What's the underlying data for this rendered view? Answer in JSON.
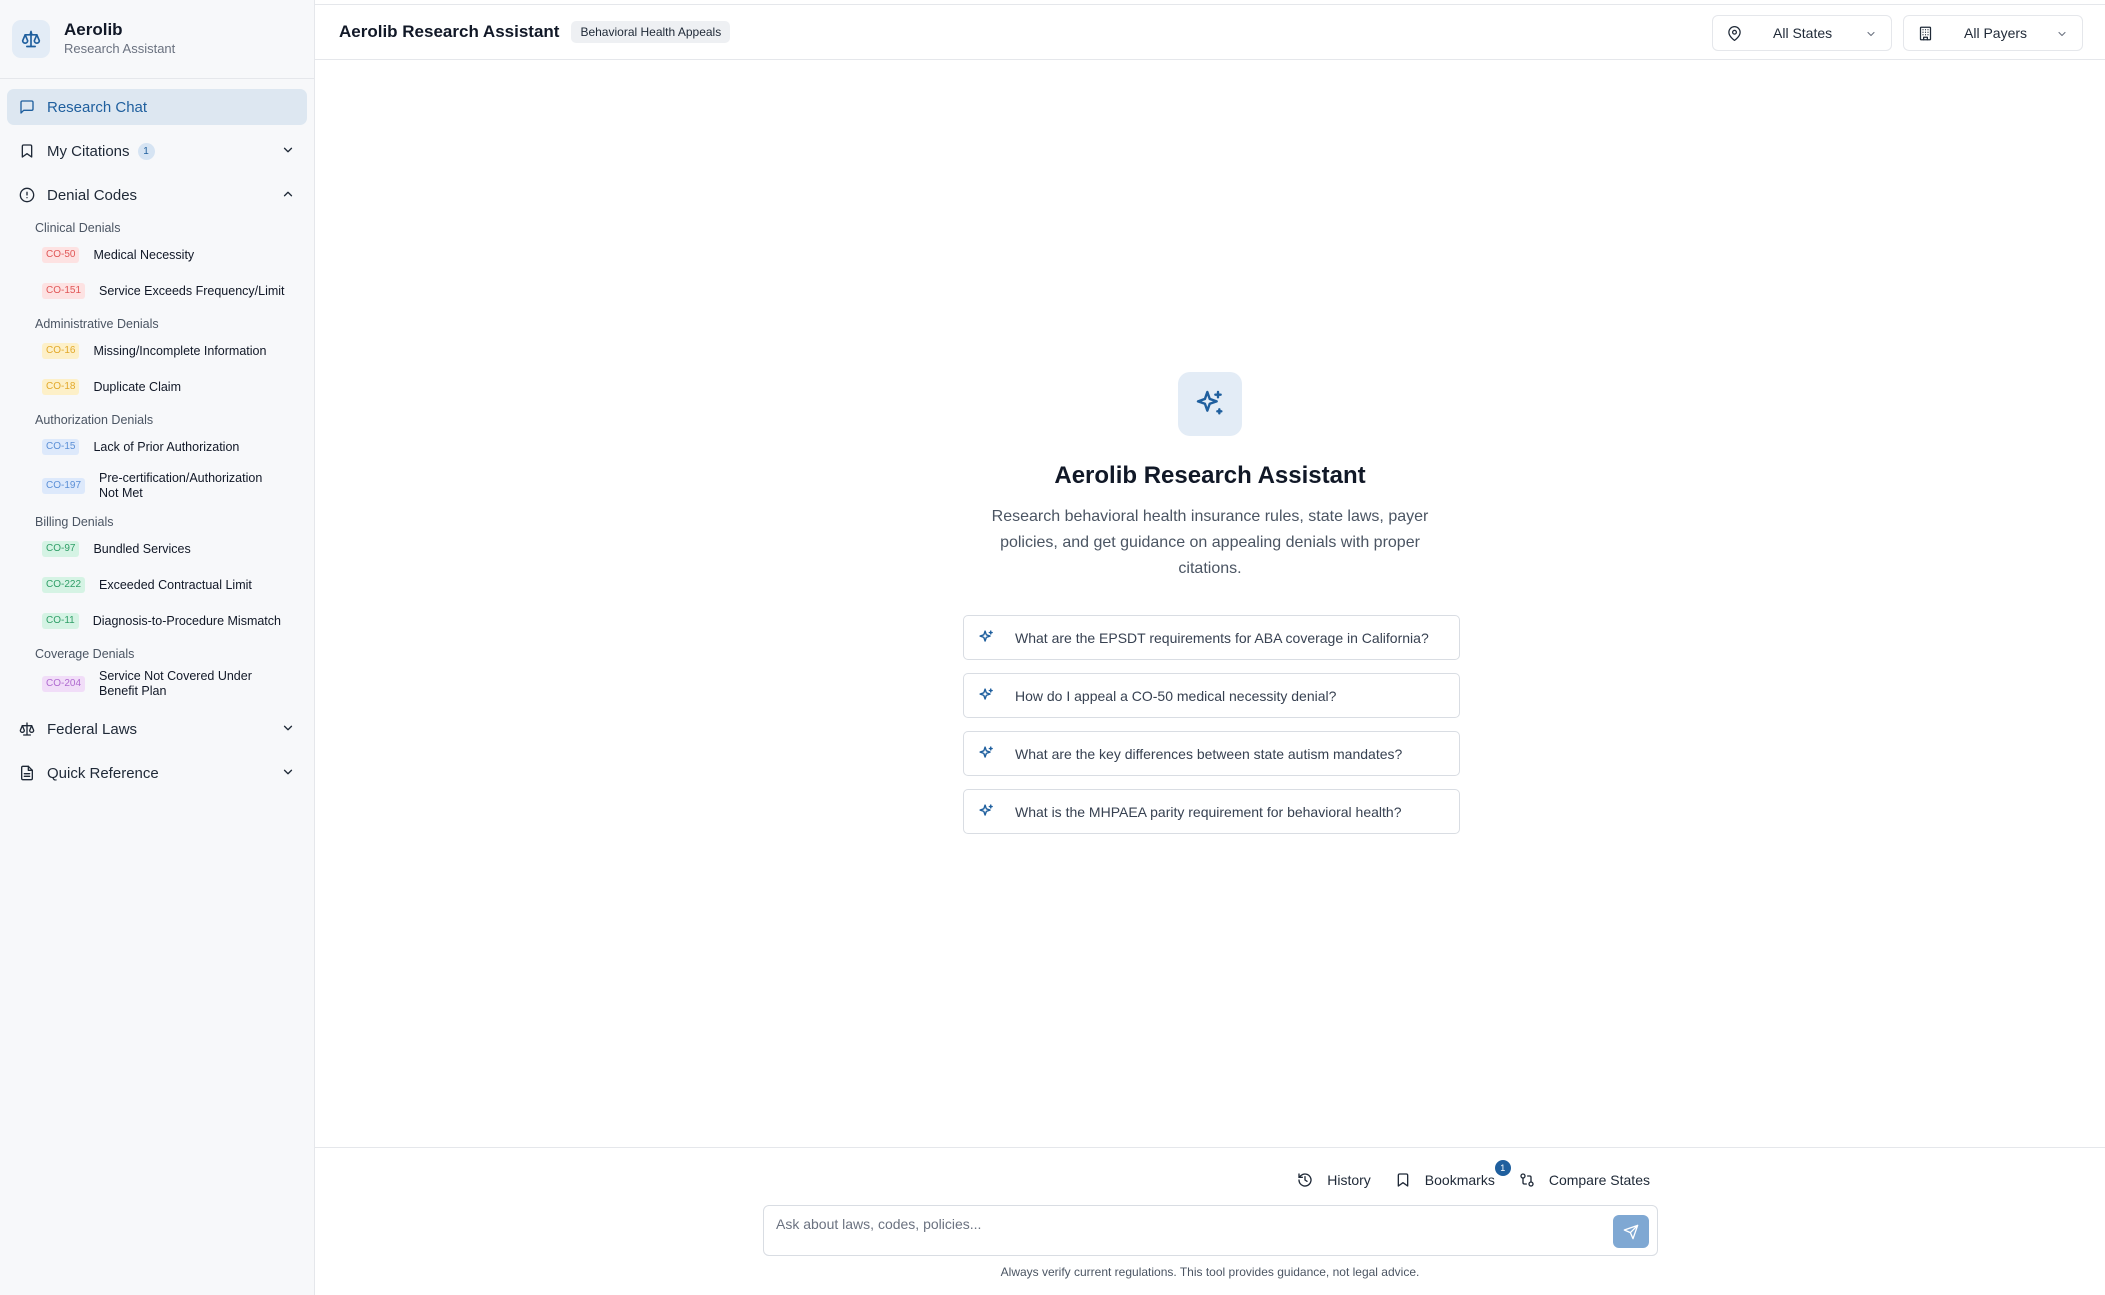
{
  "brand": {
    "name": "Aerolib",
    "subtitle": "Research Assistant"
  },
  "sidebar": {
    "research_chat": "Research Chat",
    "my_citations": {
      "label": "My Citations",
      "count": "1"
    },
    "denial_codes": "Denial Codes",
    "groups": [
      {
        "title": "Clinical Denials",
        "items": [
          {
            "code": "CO-50",
            "label": "Medical Necessity",
            "color": "#e05757"
          },
          {
            "code": "CO-151",
            "label": "Service Exceeds Frequency/Limit",
            "color": "#e05757"
          }
        ]
      },
      {
        "title": "Administrative Denials",
        "items": [
          {
            "code": "CO-16",
            "label": "Missing/Incomplete Information",
            "color": "#e2a82a"
          },
          {
            "code": "CO-18",
            "label": "Duplicate Claim",
            "color": "#e2a82a"
          }
        ]
      },
      {
        "title": "Authorization Denials",
        "items": [
          {
            "code": "CO-15",
            "label": "Lack of Prior Authorization",
            "color": "#5b8fd6"
          },
          {
            "code": "CO-197",
            "label": "Pre-certification/Authorization Not Met",
            "color": "#5b8fd6"
          }
        ]
      },
      {
        "title": "Billing Denials",
        "items": [
          {
            "code": "CO-97",
            "label": "Bundled Services",
            "color": "#2f9e67"
          },
          {
            "code": "CO-222",
            "label": "Exceeded Contractual Limit",
            "color": "#2f9e67"
          },
          {
            "code": "CO-11",
            "label": "Diagnosis-to-Procedure Mismatch",
            "color": "#2f9e67"
          }
        ]
      },
      {
        "title": "Coverage Denials",
        "items": [
          {
            "code": "CO-204",
            "label": "Service Not Covered Under Benefit Plan",
            "color": "#b06bd0"
          }
        ]
      }
    ],
    "federal_laws": "Federal Laws",
    "quick_reference": "Quick Reference"
  },
  "header": {
    "title": "Aerolib Research Assistant",
    "badge": "Behavioral Health Appeals",
    "state_filter": "All States",
    "payer_filter": "All Payers"
  },
  "hero": {
    "title": "Aerolib Research Assistant",
    "description": "Research behavioral health insurance rules, state laws, payer policies, and get guidance on appealing denials with proper citations."
  },
  "suggestions": [
    "What are the EPSDT requirements for ABA coverage in California?",
    "How do I appeal a CO-50 medical necessity denial?",
    "What are the key differences between state autism mandates?",
    "What is the MHPAEA parity requirement for behavioral health?"
  ],
  "footer": {
    "history": "History",
    "bookmarks": "Bookmarks",
    "bookmarks_count": "1",
    "compare_states": "Compare States",
    "input_placeholder": "Ask about laws, codes, policies...",
    "disclaimer": "Always verify current regulations. This tool provides guidance, not legal advice."
  },
  "colors": {
    "accent": "#1f5f9e",
    "accent_light": "#e3ecf6",
    "send_button": "#7fa8d3"
  }
}
